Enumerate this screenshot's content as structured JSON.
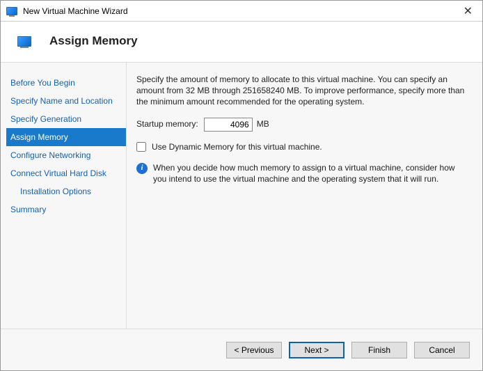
{
  "window": {
    "title": "New Virtual Machine Wizard"
  },
  "header": {
    "title": "Assign Memory"
  },
  "sidebar": {
    "items": [
      {
        "label": "Before You Begin",
        "selected": false
      },
      {
        "label": "Specify Name and Location",
        "selected": false
      },
      {
        "label": "Specify Generation",
        "selected": false
      },
      {
        "label": "Assign Memory",
        "selected": true
      },
      {
        "label": "Configure Networking",
        "selected": false
      },
      {
        "label": "Connect Virtual Hard Disk",
        "selected": false
      },
      {
        "label": "Installation Options",
        "selected": false,
        "sub": true
      },
      {
        "label": "Summary",
        "selected": false
      }
    ]
  },
  "main": {
    "description": "Specify the amount of memory to allocate to this virtual machine. You can specify an amount from 32 MB through 251658240 MB. To improve performance, specify more than the minimum amount recommended for the operating system.",
    "startup_label": "Startup memory:",
    "startup_value": "4096",
    "startup_unit": "MB",
    "dynamic_label": "Use Dynamic Memory for this virtual machine.",
    "dynamic_checked": false,
    "info_text": "When you decide how much memory to assign to a virtual machine, consider how you intend to use the virtual machine and the operating system that it will run."
  },
  "footer": {
    "previous": "< Previous",
    "next": "Next >",
    "finish": "Finish",
    "cancel": "Cancel"
  }
}
